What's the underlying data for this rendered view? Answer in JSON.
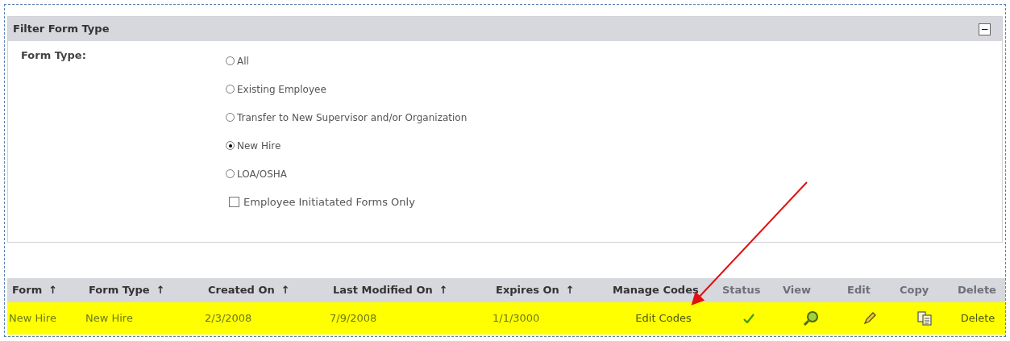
{
  "panel": {
    "title": "Filter Form Type",
    "collapse_symbol": "−",
    "field_label": "Form Type:",
    "options": [
      {
        "label": "All",
        "selected": false
      },
      {
        "label": "Existing Employee",
        "selected": false
      },
      {
        "label": "Transfer to New Supervisor and/or Organization",
        "selected": false
      },
      {
        "label": "New Hire",
        "selected": true
      },
      {
        "label": "LOA/OSHA",
        "selected": false
      }
    ],
    "checkbox": {
      "label": "Employee Initiatated Forms Only",
      "checked": false
    }
  },
  "table": {
    "columns": [
      {
        "label": "Form",
        "sort": "↑",
        "kind": "sortable"
      },
      {
        "label": "Form Type",
        "sort": "↑",
        "kind": "sortable"
      },
      {
        "label": "Created On",
        "sort": "↑",
        "kind": "sortable"
      },
      {
        "label": "Last Modified On",
        "sort": "↑",
        "kind": "sortable"
      },
      {
        "label": "Expires On",
        "sort": "↑",
        "kind": "sortable"
      },
      {
        "label": "Manage Codes",
        "kind": "plain"
      },
      {
        "label": "Status",
        "kind": "action"
      },
      {
        "label": "View",
        "kind": "action"
      },
      {
        "label": "Edit",
        "kind": "action"
      },
      {
        "label": "Copy",
        "kind": "action"
      },
      {
        "label": "Delete",
        "kind": "action"
      }
    ],
    "rows": [
      {
        "highlighted": true,
        "cells": [
          {
            "kind": "text",
            "text": "New Hire"
          },
          {
            "kind": "text",
            "text": "New Hire"
          },
          {
            "kind": "text",
            "text": "2/3/2008"
          },
          {
            "kind": "text",
            "text": "7/9/2008"
          },
          {
            "kind": "text",
            "text": "1/1/3000"
          },
          {
            "kind": "link",
            "text": "Edit Codes"
          },
          {
            "kind": "check"
          },
          {
            "kind": "view"
          },
          {
            "kind": "edit"
          },
          {
            "kind": "copy"
          },
          {
            "kind": "link",
            "text": "Delete"
          }
        ]
      }
    ]
  }
}
